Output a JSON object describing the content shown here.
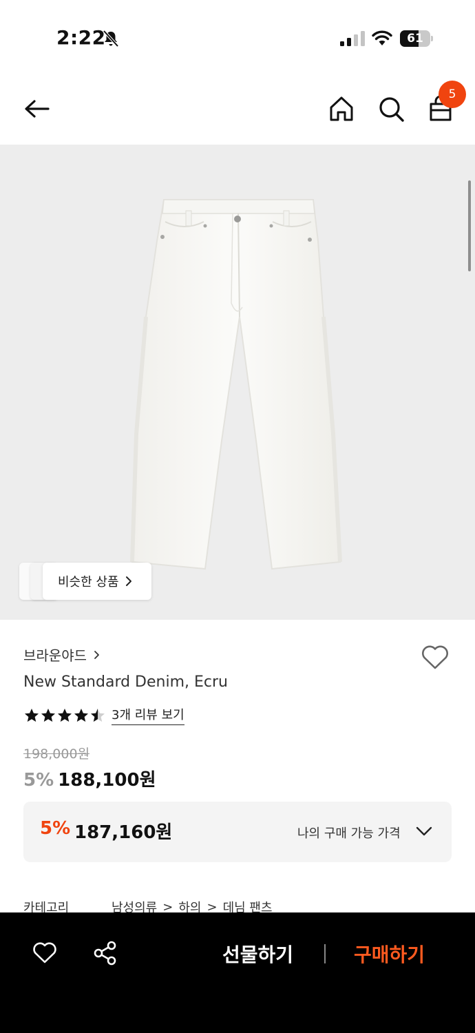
{
  "status_bar": {
    "time": "2:22",
    "battery": "61",
    "battery_level": 0.61
  },
  "header": {
    "cart_count": "5"
  },
  "hero": {
    "similar_label": "비슷한 상품"
  },
  "product": {
    "brand": "브라운야드",
    "name": "New Standard Denim, Ecru",
    "rating": 4.5,
    "review_link": "3개 리뷰 보기",
    "original_price": "198,000원",
    "discount": "5%",
    "price": "188,100원"
  },
  "my_price": {
    "discount": "5%",
    "price": "187,160원",
    "label": "나의 구매 가능 가격"
  },
  "category": {
    "label": "카테고리",
    "path": [
      "남성의류",
      "하의",
      "데님 팬츠"
    ]
  },
  "bottom_bar": {
    "gift_label": "선물하기",
    "buy_label": "구매하기"
  },
  "colors": {
    "accent": "#f0440f",
    "buy": "#ff5a1f",
    "hero_bg": "#ededed"
  }
}
